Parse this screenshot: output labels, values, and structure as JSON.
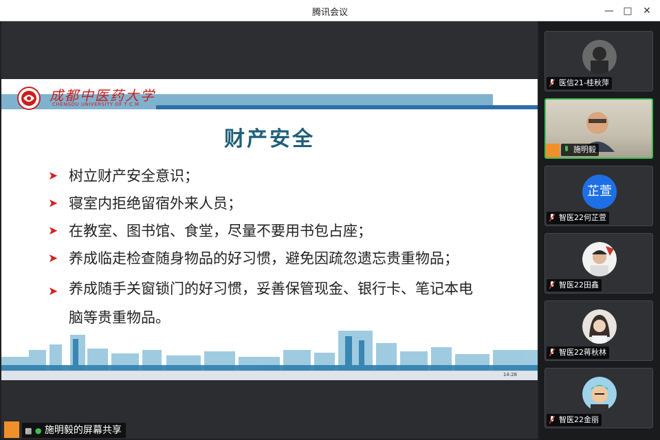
{
  "window": {
    "title": "腾讯会议"
  },
  "slide": {
    "school_cn": "成都中医药大学",
    "school_en": "CHENGDU UNIVERSITY OF T C M",
    "title": "财产安全",
    "bullets": [
      "树立财产安全意识；",
      "寝室内拒绝留宿外来人员；",
      "在教室、图书馆、食堂，尽量不要用书包占座；",
      "养成临走检查随身物品的好习惯，避免因疏忽遗忘贵重物品；",
      "养成随手关窗锁门的好习惯，妥善保管现金、银行卡、笔记本电",
      "脑等贵重物品。"
    ],
    "taskbar_time": "14:28"
  },
  "share": {
    "label": "施明毅的屏幕共享"
  },
  "participants": [
    {
      "name": "医信21-桂秋萍",
      "avatar": "portrait"
    },
    {
      "name": "施明毅",
      "avatar": "video"
    },
    {
      "name": "智医22何芷萱",
      "avatar": "initials",
      "initials": "芷萱"
    },
    {
      "name": "智医22田鑫",
      "avatar": "portrait"
    },
    {
      "name": "智医22蒋秋林",
      "avatar": "portrait"
    },
    {
      "name": "智医22金丽",
      "avatar": "portrait"
    }
  ],
  "colors": {
    "accent_red": "#d4201a",
    "title_blue": "#1f5f7a",
    "active_green": "#3fbf55",
    "initials_blue": "#1e6fe6"
  }
}
